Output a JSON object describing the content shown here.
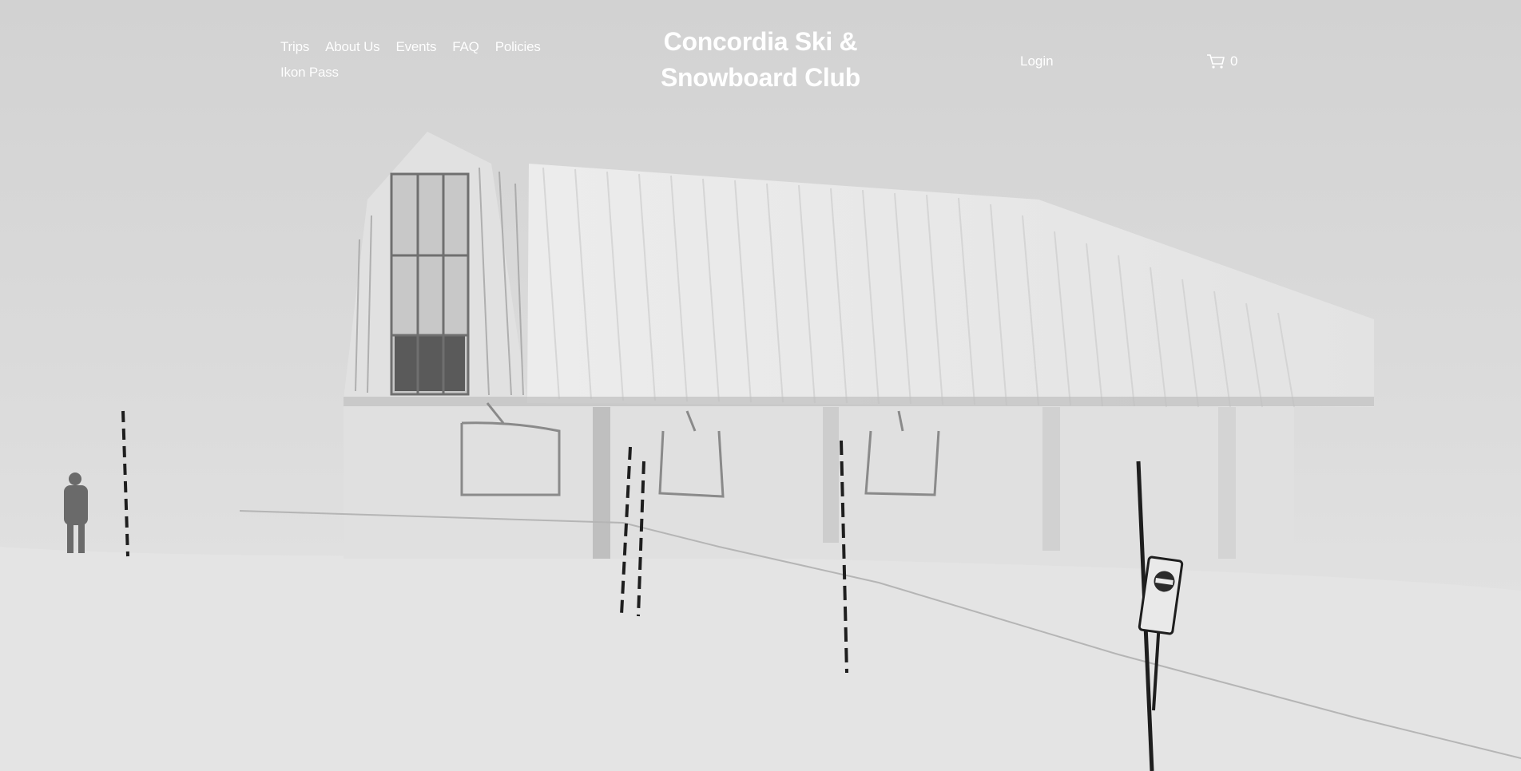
{
  "header": {
    "nav": [
      {
        "label": "Trips"
      },
      {
        "label": "About Us"
      },
      {
        "label": "Events"
      },
      {
        "label": "FAQ"
      },
      {
        "label": "Policies"
      },
      {
        "label": "Ikon Pass"
      }
    ],
    "site_title": "Concordia Ski & Snowboard Club",
    "login_label": "Login",
    "cart_count": "0",
    "cart_icon": "cart-icon"
  },
  "hero": {
    "subject": "Foggy ski lift station with chairlifts, poles and trail closed sign"
  },
  "colors": {
    "background": "#d3d3d3",
    "header_text": "#ffffff"
  }
}
